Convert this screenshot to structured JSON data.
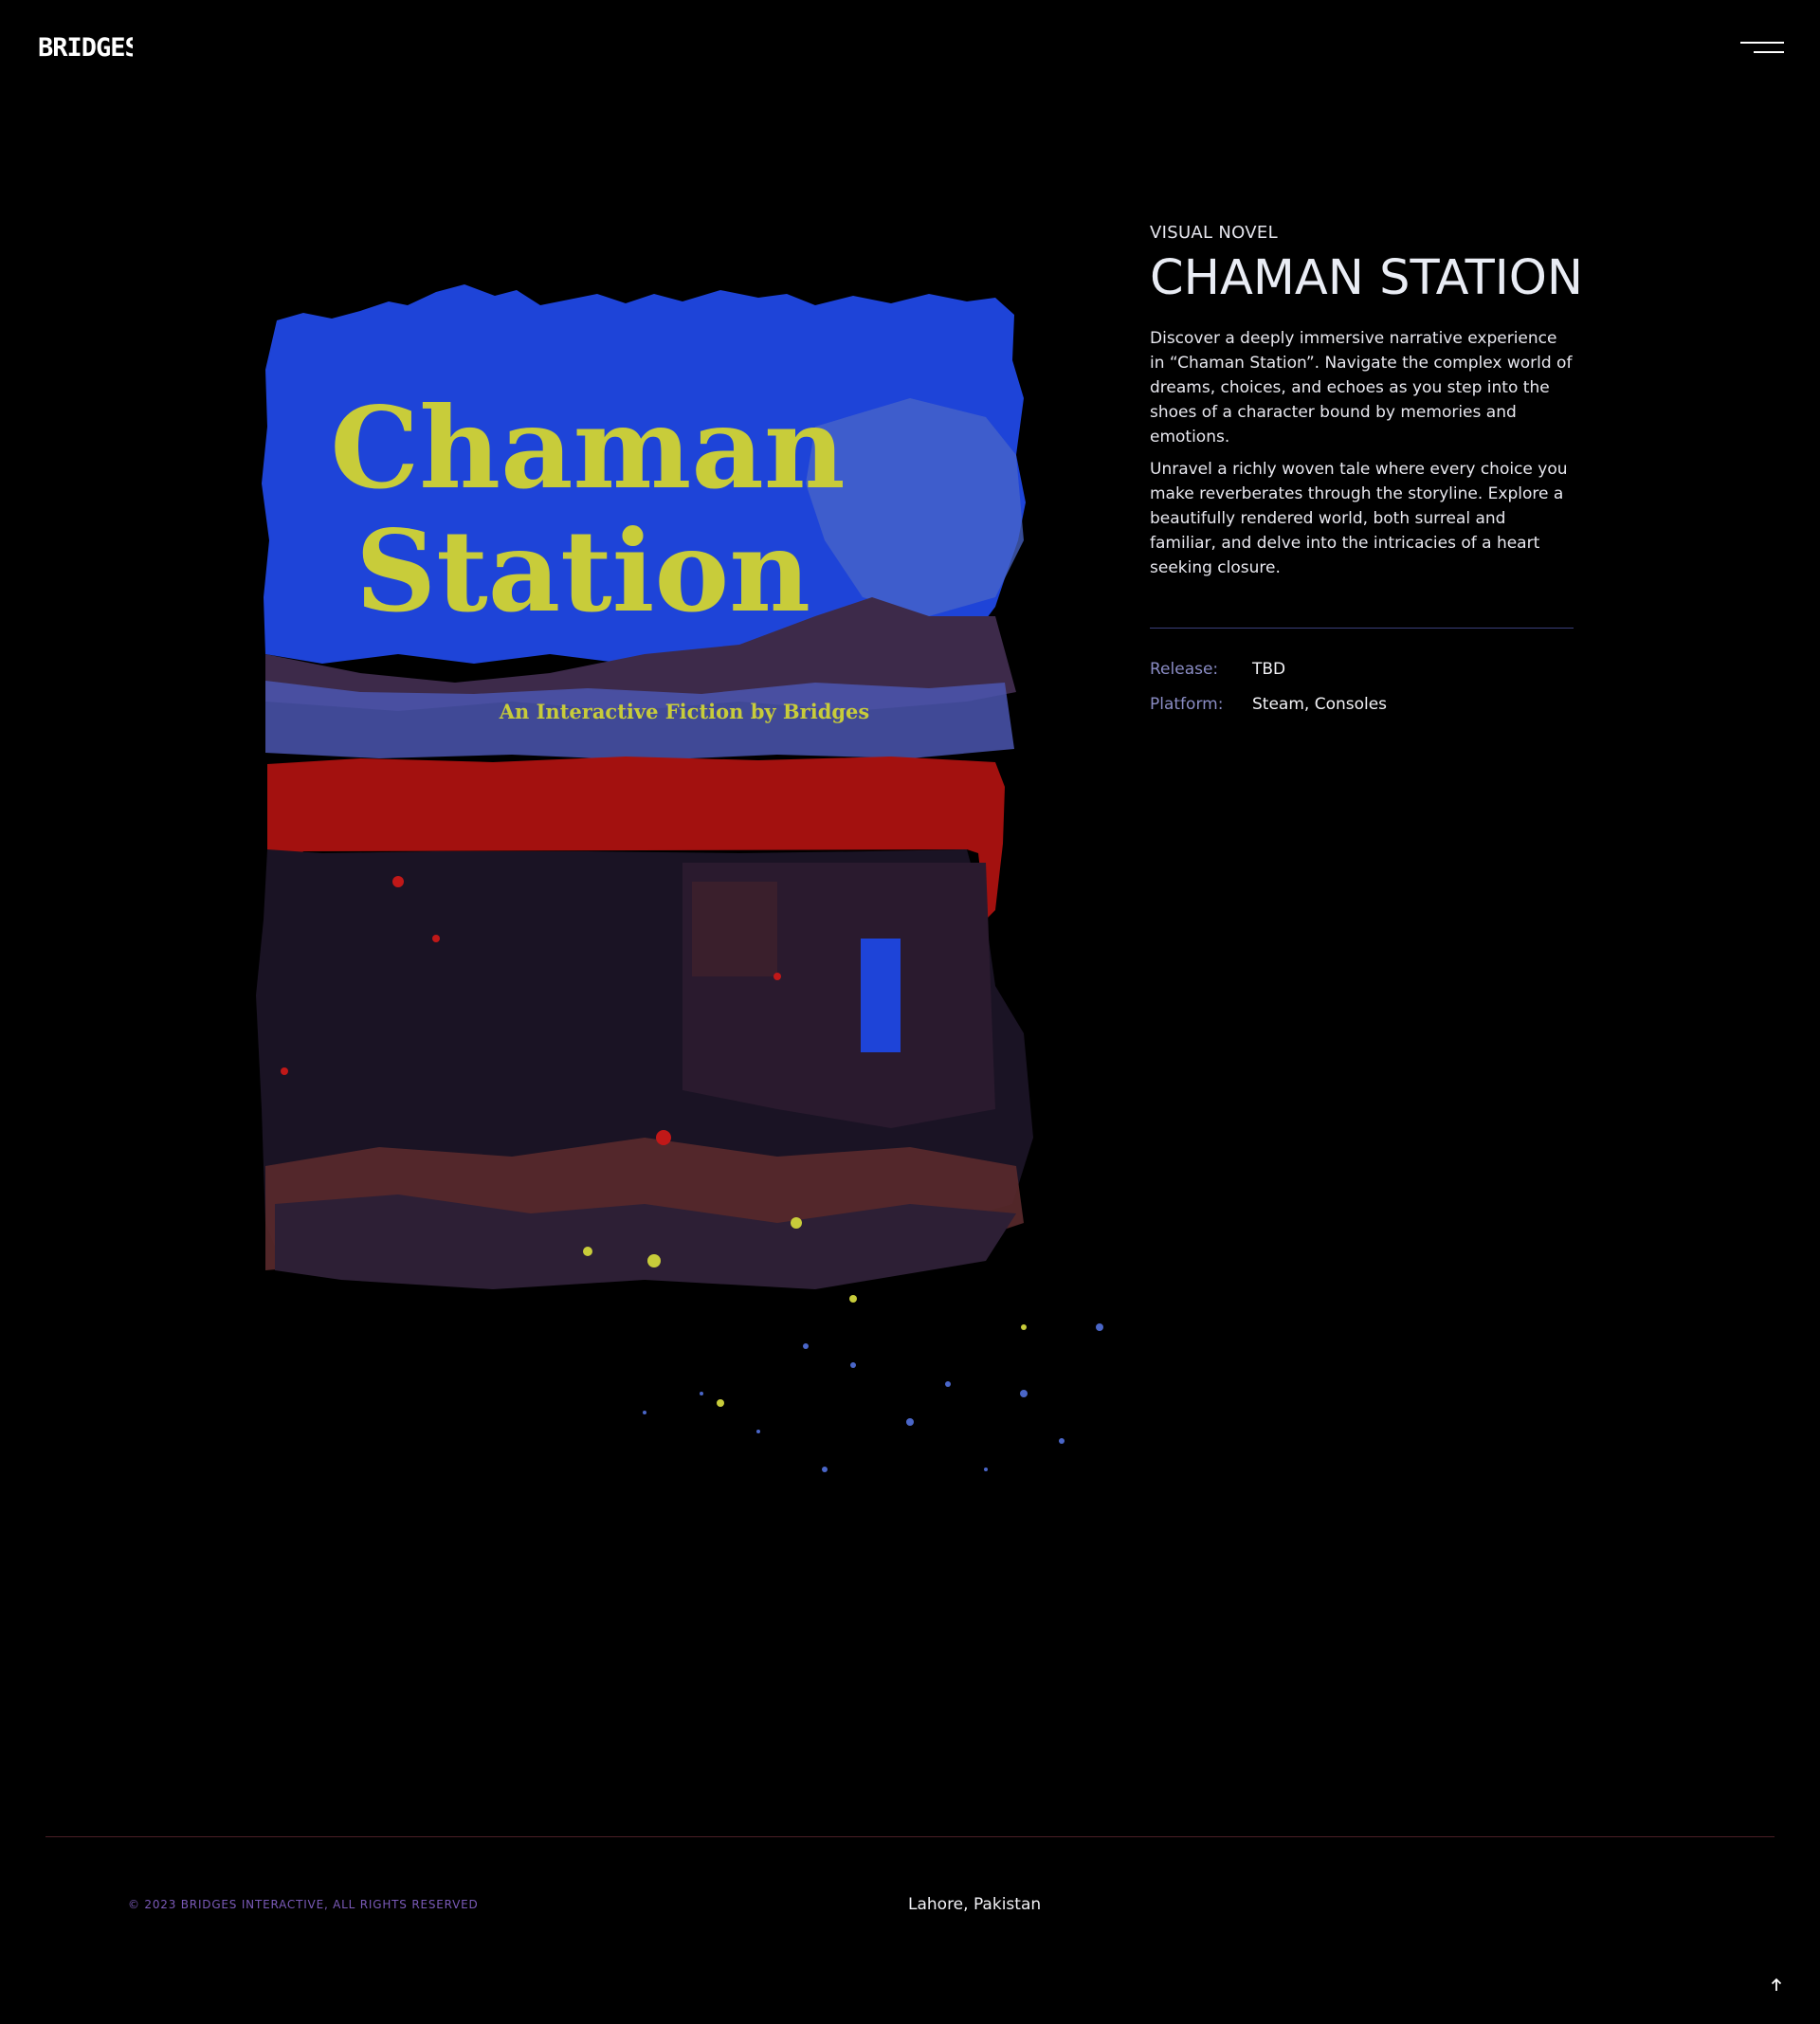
{
  "header": {
    "logo_text": "BRIDGES",
    "menu_icon": "hamburger-menu-icon"
  },
  "cover": {
    "title_line1": "Chaman",
    "title_line2": "Station",
    "subtitle": "An Interactive Fiction by Bridges",
    "colors": {
      "sky": "#1e44d8",
      "sky_light": "#4a66c8",
      "title": "#c8cc3a",
      "awning": "#a3110f",
      "dark": "#1a1324",
      "brown": "#5a2a2c"
    }
  },
  "info": {
    "genre": "VISUAL NOVEL",
    "title": "CHAMAN STATION",
    "paragraph1": "Discover a deeply immersive narrative experience in “Chaman Station”. Navigate the complex world of dreams, choices, and echoes as you step into the shoes of a character bound by memories and emotions.",
    "paragraph2": "Unravel a richly woven tale where every choice you make reverberates through the storyline. Explore a beautifully rendered world, both surreal and familiar, and delve into the intricacies of a heart seeking closure.",
    "release_label": "Release:",
    "release_value": "TBD",
    "platform_label": "Platform:",
    "platform_value": "Steam, Consoles"
  },
  "footer": {
    "copyright": "© 2023 BRIDGES INTERACTIVE, ALL RIGHTS RESERVED",
    "location": "Lahore, Pakistan",
    "scroll_top_icon": "arrow-up-icon"
  }
}
